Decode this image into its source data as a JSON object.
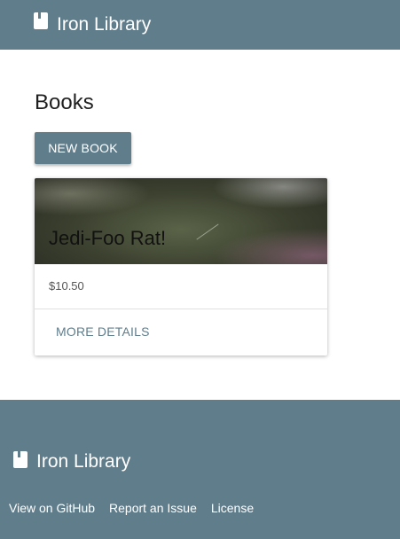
{
  "header": {
    "icon": "book-icon",
    "title": "Iron Library"
  },
  "main": {
    "title": "Books",
    "new_book_label": "NEW BOOK",
    "cards": [
      {
        "title": "Jedi-Foo Rat!",
        "price": "$10.50",
        "action_label": "MORE DETAILS"
      }
    ]
  },
  "footer": {
    "icon": "book-icon",
    "title": "Iron Library",
    "links": [
      "View on GitHub",
      "Report an Issue",
      "License"
    ]
  },
  "colors": {
    "primary": "#607d8b",
    "header_text": "#ffffff",
    "link": "#607d8b"
  }
}
